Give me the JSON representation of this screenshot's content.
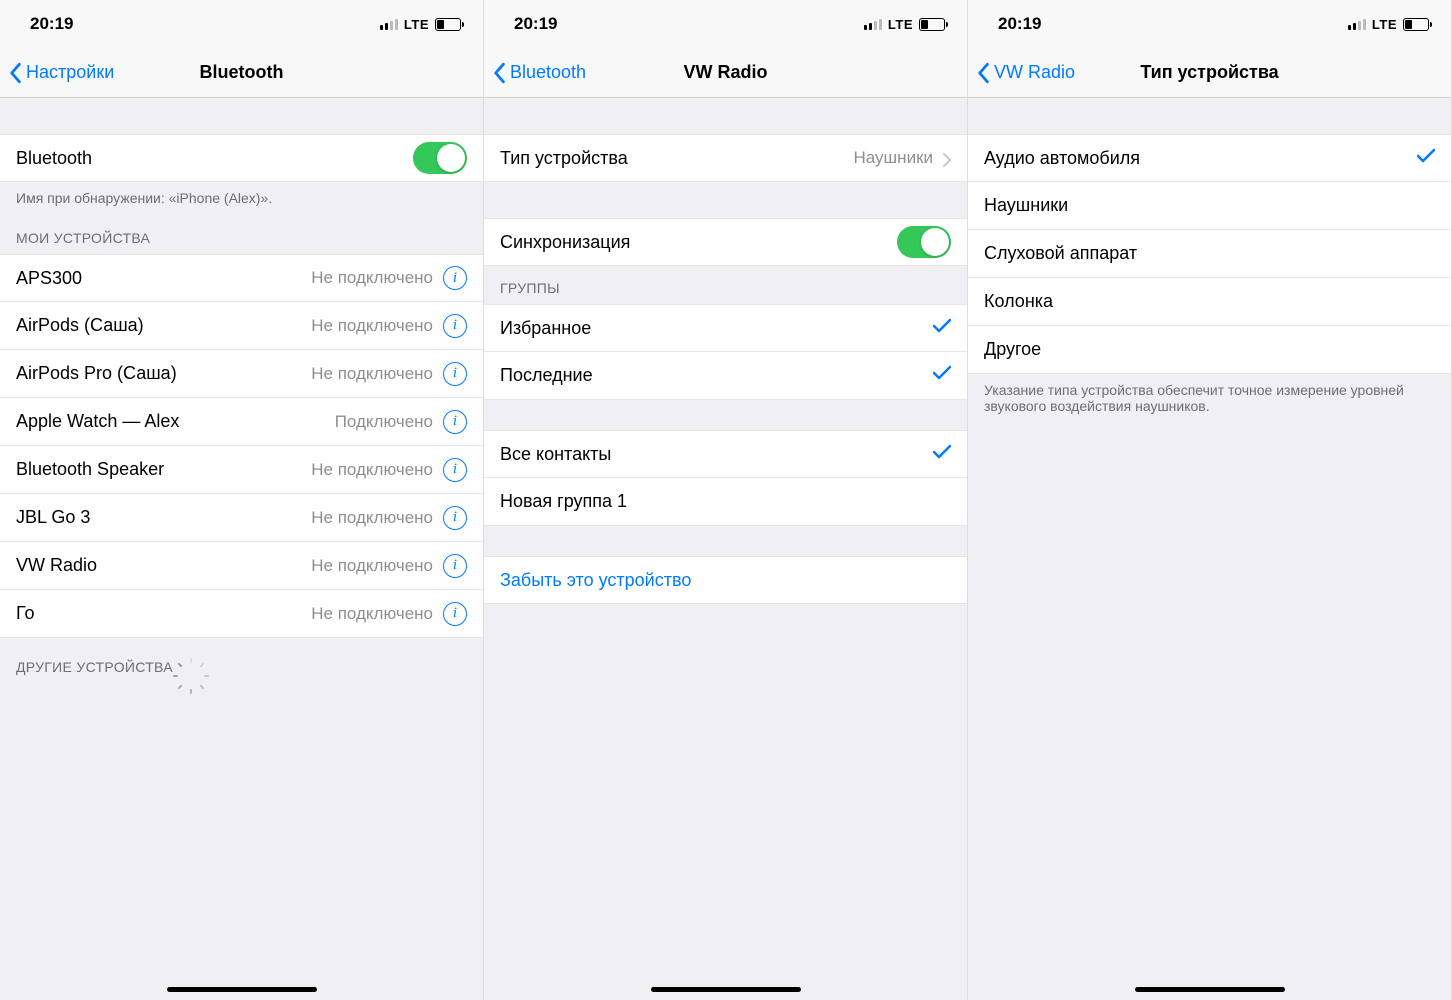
{
  "status": {
    "time": "20:19",
    "network": "LTE"
  },
  "screen1": {
    "back": "Настройки",
    "title": "Bluetooth",
    "toggle_label": "Bluetooth",
    "discoverable": "Имя при обнаружении: «iPhone (Alex)».",
    "my_devices_header": "МОИ УСТРОЙСТВА",
    "devices": [
      {
        "name": "APS300",
        "status": "Не подключено"
      },
      {
        "name": "AirPods (Саша)",
        "status": "Не подключено"
      },
      {
        "name": "AirPods Pro (Саша)",
        "status": "Не подключено"
      },
      {
        "name": "Apple Watch — Alex",
        "status": "Подключено"
      },
      {
        "name": "Bluetooth Speaker",
        "status": "Не подключено"
      },
      {
        "name": "JBL Go 3",
        "status": "Не подключено"
      },
      {
        "name": "VW Radio",
        "status": "Не подключено"
      },
      {
        "name": "Го",
        "status": "Не подключено"
      }
    ],
    "other_header": "ДРУГИЕ УСТРОЙСТВА"
  },
  "screen2": {
    "back": "Bluetooth",
    "title": "VW Radio",
    "type_label": "Тип устройства",
    "type_value": "Наушники",
    "sync_label": "Синхронизация",
    "groups_header": "ГРУППЫ",
    "group1": [
      {
        "name": "Избранное",
        "checked": true
      },
      {
        "name": "Последние",
        "checked": true
      }
    ],
    "group2": [
      {
        "name": "Все контакты",
        "checked": true
      },
      {
        "name": "Новая группа 1",
        "checked": false
      }
    ],
    "forget": "Забыть это устройство"
  },
  "screen3": {
    "back": "VW Radio",
    "title": "Тип устройства",
    "options": [
      {
        "name": "Аудио автомобиля",
        "checked": true
      },
      {
        "name": "Наушники",
        "checked": false
      },
      {
        "name": "Слуховой аппарат",
        "checked": false
      },
      {
        "name": "Колонка",
        "checked": false
      },
      {
        "name": "Другое",
        "checked": false
      }
    ],
    "footer": "Указание типа устройства обеспечит точное измерение уровней звукового воздействия наушников."
  }
}
